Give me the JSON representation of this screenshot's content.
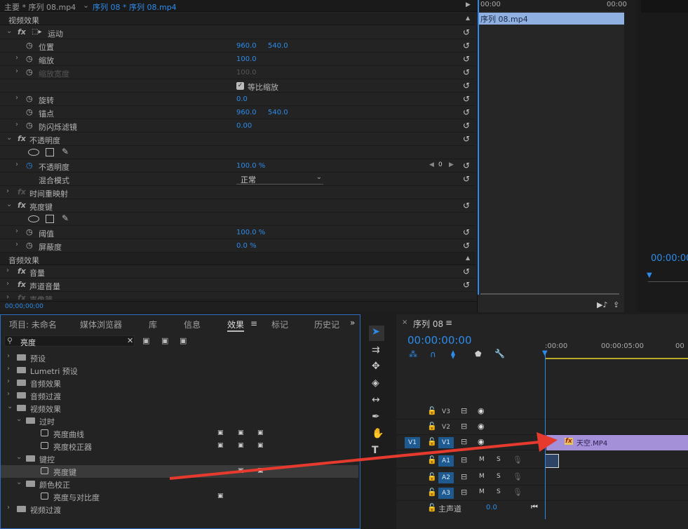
{
  "effect_controls": {
    "tab_master": "主要 * 序列 08.mp4",
    "tab_sequence": "序列 08 * 序列 08.mp4",
    "section_video": "视频效果",
    "motion": "运动",
    "position": "位置",
    "position_x": "960.0",
    "position_y": "540.0",
    "scale": "缩放",
    "scale_val": "100.0",
    "scale_width": "缩放宽度",
    "scale_width_val": "100.0",
    "uniform_scale": "等比缩放",
    "rotation": "旋转",
    "rotation_val": "0.0",
    "anchor": "锚点",
    "anchor_x": "960.0",
    "anchor_y": "540.0",
    "anti_flicker": "防闪烁滤镜",
    "anti_flicker_val": "0.00",
    "opacity_group": "不透明度",
    "opacity": "不透明度",
    "opacity_val": "100.0 %",
    "keyframe_value": "0",
    "blend_mode": "混合模式",
    "blend_mode_val": "正常",
    "time_remap": "时间重映射",
    "luma_key": "亮度键",
    "threshold": "阈值",
    "threshold_val": "100.0 %",
    "cutoff": "屏蔽度",
    "cutoff_val": "0.0 %",
    "section_audio": "音频效果",
    "volume": "音量",
    "channel_volume": "声道音量",
    "panner": "声像器",
    "timecode": "00;00;00;00",
    "ruler_start": "00:00",
    "ruler_end": "00:00",
    "clip_name": "序列 08.mp4"
  },
  "program": {
    "timecode": "00:00:00"
  },
  "project": {
    "tabs": [
      "项目: 未命名",
      "媒体浏览器",
      "库",
      "信息",
      "效果",
      "标记",
      "历史记"
    ],
    "search_value": "亮度",
    "tree": [
      {
        "label": "预设",
        "level": 0,
        "kind": "folder"
      },
      {
        "label": "Lumetri 预设",
        "level": 0,
        "kind": "folder"
      },
      {
        "label": "音频效果",
        "level": 0,
        "kind": "folder"
      },
      {
        "label": "音频过渡",
        "level": 0,
        "kind": "folder"
      },
      {
        "label": "视频效果",
        "level": 0,
        "kind": "folder"
      },
      {
        "label": "过时",
        "level": 1,
        "kind": "folder"
      },
      {
        "label": "亮度曲线",
        "level": 2,
        "kind": "effect"
      },
      {
        "label": "亮度校正器",
        "level": 2,
        "kind": "effect"
      },
      {
        "label": "键控",
        "level": 1,
        "kind": "folder"
      },
      {
        "label": "亮度键",
        "level": 2,
        "kind": "effect"
      },
      {
        "label": "颜色校正",
        "level": 1,
        "kind": "folder"
      },
      {
        "label": "亮度与对比度",
        "level": 2,
        "kind": "effect"
      },
      {
        "label": "视频过渡",
        "level": 0,
        "kind": "folder"
      }
    ]
  },
  "sequence": {
    "tab": "序列 08",
    "timecode": "00:00:00:00",
    "ruler": [
      ":00:00",
      "00:00:05:00",
      "00"
    ],
    "tracks": [
      "V3",
      "V2",
      "V1",
      "A1",
      "A2",
      "A3"
    ],
    "source_v1": "V1",
    "master": "主声道",
    "master_val": "0.0",
    "clip": "天空.MP4",
    "m": "M",
    "s": "S"
  },
  "colors": {
    "accent": "#2d8ceb",
    "clip": "#a48fd9",
    "arrow": "#e63a2e"
  }
}
